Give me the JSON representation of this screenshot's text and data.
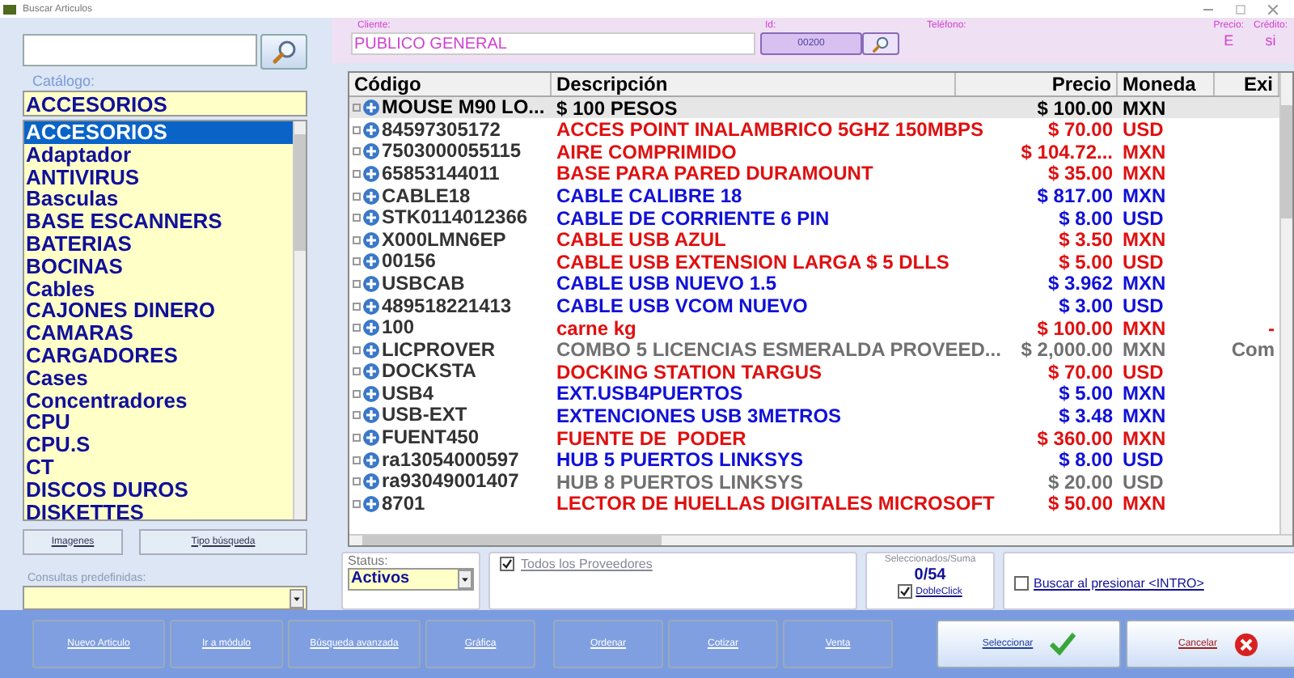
{
  "window": {
    "title": "Buscar Articulos"
  },
  "catalog": {
    "label": "Catálogo:",
    "value": "ACCESORIOS",
    "items": [
      {
        "label": "ACCESORIOS",
        "selected": true
      },
      {
        "label": "Adaptador",
        "selected": false
      },
      {
        "label": "ANTIVIRUS",
        "selected": false
      },
      {
        "label": "Basculas",
        "selected": false
      },
      {
        "label": "BASE ESCANNERS",
        "selected": false
      },
      {
        "label": "BATERIAS",
        "selected": false
      },
      {
        "label": "BOCINAS",
        "selected": false
      },
      {
        "label": "Cables",
        "selected": false
      },
      {
        "label": "CAJONES DINERO",
        "selected": false
      },
      {
        "label": "CAMARAS",
        "selected": false
      },
      {
        "label": "CARGADORES",
        "selected": false
      },
      {
        "label": "Cases",
        "selected": false
      },
      {
        "label": "Concentradores",
        "selected": false
      },
      {
        "label": "CPU",
        "selected": false
      },
      {
        "label": "CPU.S",
        "selected": false
      },
      {
        "label": "CT",
        "selected": false
      },
      {
        "label": "DISCOS DUROS",
        "selected": false
      },
      {
        "label": "DISKETTES",
        "selected": false
      }
    ]
  },
  "left_buttons": [
    "Imagenes",
    "Tipo búsqueda"
  ],
  "predefined": {
    "label": "Consultas predefinidas:"
  },
  "client": {
    "label": "Cliente:",
    "value": "PUBLICO GENERAL",
    "id_label": "Id:",
    "id": "00200",
    "phone_label": "Teléfono:",
    "price_label": "Precio:",
    "price": "E",
    "credit_label": "Crédito:",
    "credit": "si"
  },
  "table": {
    "columns": [
      "Código",
      "Descripción",
      "Precio",
      "Moneda",
      "Exi"
    ],
    "rows": [
      {
        "code": "MOUSE M90 LO...",
        "description": "$ 100 PESOS",
        "price": "$ 100.00",
        "currency": "MXN",
        "color": "#000000",
        "selected": true
      },
      {
        "code": "84597305172",
        "description": "ACCES POINT INALAMBRICO 5GHZ 150MBPS",
        "price": "$ 70.00",
        "currency": "USD",
        "color": "#e01010",
        "selected": false
      },
      {
        "code": "7503000055115",
        "description": "AIRE COMPRIMIDO",
        "price": "$ 104.72...",
        "currency": "MXN",
        "color": "#e01010",
        "selected": false
      },
      {
        "code": "65853144011",
        "description": "BASE PARA PARED DURAMOUNT",
        "price": "$ 35.00",
        "currency": "MXN",
        "color": "#e01010",
        "selected": false
      },
      {
        "code": "CABLE18",
        "description": "CABLE CALIBRE 18",
        "price": "$ 817.00",
        "currency": "MXN",
        "color": "#1010d8",
        "selected": false
      },
      {
        "code": "STK0114012366",
        "description": "CABLE DE CORRIENTE 6 PIN",
        "price": "$ 8.00",
        "currency": "USD",
        "color": "#1010d8",
        "selected": false
      },
      {
        "code": "X000LMN6EP",
        "description": "CABLE USB AZUL",
        "price": "$ 3.50",
        "currency": "MXN",
        "color": "#e01010",
        "selected": false
      },
      {
        "code": "00156",
        "description": "CABLE USB EXTENSION LARGA $ 5 DLLS",
        "price": "$ 5.00",
        "currency": "USD",
        "color": "#e01010",
        "selected": false
      },
      {
        "code": "USBCAB",
        "description": "CABLE USB NUEVO 1.5",
        "price": "$ 3.962",
        "currency": "MXN",
        "color": "#1010d8",
        "selected": false
      },
      {
        "code": "489518221413",
        "description": "CABLE USB VCOM NUEVO",
        "price": "$ 3.00",
        "currency": "USD",
        "color": "#1010d8",
        "selected": false
      },
      {
        "code": "100",
        "description": "carne kg",
        "price": "$ 100.00",
        "currency": "MXN",
        "column_5": "-",
        "color": "#e01010",
        "selected": false
      },
      {
        "code": "LICPROVER",
        "description": "COMBO 5 LICENCIAS ESMERALDA PROVEED...",
        "price": "$ 2,000.00",
        "currency": "MXN",
        "column_5": "Com",
        "color": "#707070",
        "selected": false
      },
      {
        "code": "DOCKSTA",
        "description": "DOCKING STATION TARGUS",
        "price": "$ 70.00",
        "currency": "USD",
        "color": "#e01010",
        "selected": false
      },
      {
        "code": "USB4",
        "description": "EXT.USB4PUERTOS",
        "price": "$ 5.00",
        "currency": "MXN",
        "color": "#1010d8",
        "selected": false
      },
      {
        "code": "USB-EXT",
        "description": "EXTENCIONES USB 3METROS",
        "price": "$ 3.48",
        "currency": "MXN",
        "color": "#1010d8",
        "selected": false
      },
      {
        "code": "FUENT450",
        "description": "FUENTE DE  PODER",
        "price": "$ 360.00",
        "currency": "MXN",
        "color": "#e01010",
        "selected": false
      },
      {
        "code": "ra13054000597",
        "description": "HUB 5 PUERTOS LINKSYS",
        "price": "$ 8.00",
        "currency": "USD",
        "color": "#1010d8",
        "selected": false
      },
      {
        "code": "ra93049001407",
        "description": "HUB 8 PUERTOS LINKSYS",
        "price": "$ 20.00",
        "currency": "USD",
        "color": "#707070",
        "selected": false
      },
      {
        "code": "8701",
        "description": "LECTOR DE HUELLAS DIGITALES MICROSOFT",
        "price": "$ 50.00",
        "currency": "MXN",
        "color": "#e01010",
        "selected": false
      }
    ]
  },
  "status": {
    "label": "Status:",
    "value": "Activos"
  },
  "providers": {
    "label": "Todos los Proveedores",
    "checked": true
  },
  "selection": {
    "label": "Seleccionados/Suma",
    "count": "0/54",
    "double_click_label": "DobleClick",
    "double_click": true
  },
  "enter_search": {
    "label": "Buscar al presionar <INTRO>",
    "checked": false
  },
  "actions": [
    {
      "label": "Nuevo Articulo",
      "kind": "plain"
    },
    {
      "label": "Ir a módulo",
      "kind": "plain"
    },
    {
      "label": "Búsqueda avanzada",
      "kind": "plain"
    },
    {
      "label": "Gráfica",
      "kind": "plain"
    },
    {
      "label": "Ordenar",
      "kind": "plain"
    },
    {
      "label": "Cotizar",
      "kind": "plain"
    },
    {
      "label": "Venta",
      "kind": "plain"
    },
    {
      "label": "Seleccionar",
      "kind": "accept"
    },
    {
      "label": "Cancelar",
      "kind": "cancel"
    }
  ]
}
